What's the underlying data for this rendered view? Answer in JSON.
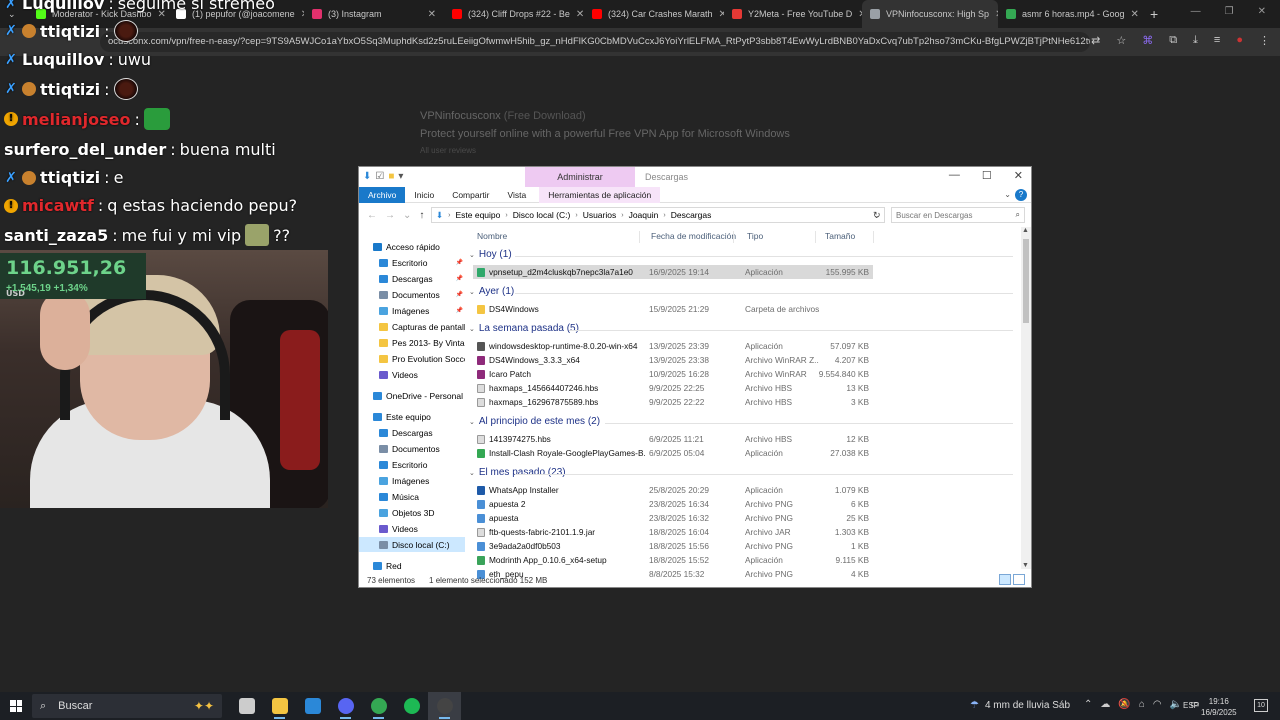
{
  "browser": {
    "tabs": [
      {
        "label": "Moderator - Kick Dashbo",
        "color": "#53fc18"
      },
      {
        "label": "(1) pepufor (@joacomene",
        "color": "#ffffff"
      },
      {
        "label": "(3) Instagram",
        "color": "#e1306c"
      },
      {
        "label": "(324) Cliff Drops #22 - Be",
        "color": "#ff0000"
      },
      {
        "label": "(324) Car Crashes Marath",
        "color": "#ff0000"
      },
      {
        "label": "Y2Meta - Free YouTube D",
        "color": "#e53935"
      },
      {
        "label": "VPNinfocusconx: High Sp",
        "color": "#9aa0a6"
      },
      {
        "label": "asmr 6 horas.mp4 - Goog",
        "color": "#34a853"
      }
    ],
    "url": "ocusconx.com/vpn/free-n-easy/?cep=9TS9A5WJCo1aYbxO5Sq3MuphdKsd2z5ruLEeiigOfwmwH5hib_gz_nHdFlKG0CbMDVuCcxJ6YoiYrlELFMA_RtPytP3sbb8T4EwWyLrdBNB0YaDxCvq7ubTp2hso73mCKu-BfgLPWZjBTjPtNHe612twTU..."
  },
  "background_page": {
    "title": "VPNinfocusconx",
    "subtitle": "(Free Download)",
    "tagline": "Protect yourself online with a powerful Free VPN App for Microsoft Windows",
    "reviews": "All user reviews"
  },
  "chat": [
    {
      "user": "Luquillov",
      "color": "#ffffff",
      "text": "seguime si stremeo",
      "badge": "mod"
    },
    {
      "user": "ttiqtizi",
      "color": "#ffffff",
      "text": "",
      "badge": "sub",
      "emote": "face"
    },
    {
      "user": "Luquillov",
      "color": "#ffffff",
      "text": "uwu",
      "badge": "mod"
    },
    {
      "user": "ttiqtizi",
      "color": "#ffffff",
      "text": "",
      "badge": "sub",
      "emote": "face"
    },
    {
      "user": "melianjoseo",
      "color": "#e0282c",
      "text": "",
      "badge": "warn",
      "emote": "bag"
    },
    {
      "user": "surfero_del_under",
      "color": "#ffffff",
      "text": "buena multi",
      "badge": ""
    },
    {
      "user": "ttiqtizi",
      "color": "#ffffff",
      "text": "e",
      "badge": "sub"
    },
    {
      "user": "micawtf",
      "color": "#e0282c",
      "text": "q estas haciendo pepu?",
      "badge": "warn"
    },
    {
      "user": "santi_zaza5",
      "color": "#ffffff",
      "text": "me fui y mi vip",
      "badge": "",
      "emote": "sus",
      "suffix": "??"
    }
  ],
  "ticker": {
    "price": "116.951,26",
    "currency": "USD",
    "change": "+1.545,19",
    "percent": "+1,34%"
  },
  "explorer": {
    "context_tab": "Administrar",
    "window_title": "Descargas",
    "ribbon": [
      "Archivo",
      "Inicio",
      "Compartir",
      "Vista",
      "Herramientas de aplicación"
    ],
    "breadcrumb": [
      "Este equipo",
      "Disco local (C:)",
      "Usuarios",
      "Joaquin",
      "Descargas"
    ],
    "search_placeholder": "Buscar en Descargas",
    "columns": {
      "name": "Nombre",
      "date": "Fecha de modificación",
      "type": "Tipo",
      "size": "Tamaño"
    },
    "nav": [
      {
        "label": "Acceso rápido",
        "color": "#1979ca",
        "indent": 0,
        "pin": false
      },
      {
        "label": "Escritorio",
        "color": "#2b88d8",
        "indent": 1,
        "pin": true
      },
      {
        "label": "Descargas",
        "color": "#2b88d8",
        "indent": 1,
        "pin": true
      },
      {
        "label": "Documentos",
        "color": "#7a8ea6",
        "indent": 1,
        "pin": true
      },
      {
        "label": "Imágenes",
        "color": "#4aa3df",
        "indent": 1,
        "pin": true
      },
      {
        "label": "Capturas de pantall",
        "color": "#f4c542",
        "indent": 1,
        "pin": false
      },
      {
        "label": "Pes 2013- By Vintag",
        "color": "#f4c542",
        "indent": 1,
        "pin": false
      },
      {
        "label": "Pro Evolution Socce",
        "color": "#f4c542",
        "indent": 1,
        "pin": false
      },
      {
        "label": "Videos",
        "color": "#6a5acd",
        "indent": 1,
        "pin": false
      },
      {
        "label": "OneDrive - Personal",
        "color": "#2b88d8",
        "indent": 0,
        "pin": false
      },
      {
        "label": "Este equipo",
        "color": "#2b88d8",
        "indent": 0,
        "pin": false
      },
      {
        "label": "Descargas",
        "color": "#2b88d8",
        "indent": 1,
        "pin": false
      },
      {
        "label": "Documentos",
        "color": "#7a8ea6",
        "indent": 1,
        "pin": false
      },
      {
        "label": "Escritorio",
        "color": "#2b88d8",
        "indent": 1,
        "pin": false
      },
      {
        "label": "Imágenes",
        "color": "#4aa3df",
        "indent": 1,
        "pin": false
      },
      {
        "label": "Música",
        "color": "#2b88d8",
        "indent": 1,
        "pin": false
      },
      {
        "label": "Objetos 3D",
        "color": "#4aa3df",
        "indent": 1,
        "pin": false
      },
      {
        "label": "Videos",
        "color": "#6a5acd",
        "indent": 1,
        "pin": false
      },
      {
        "label": "Disco local (C:)",
        "color": "#7a8ea6",
        "indent": 1,
        "pin": false,
        "selected": true
      },
      {
        "label": "Red",
        "color": "#2b88d8",
        "indent": 0,
        "pin": false
      }
    ],
    "groups": [
      {
        "label": "Hoy (1)",
        "files": [
          {
            "name": "vpnsetup_d2m4cluskqb7nepc3la7a1e0",
            "date": "16/9/2025 19:14",
            "type": "Aplicación",
            "size": "155.995 KB",
            "icon": "#2fa86a",
            "selected": true
          }
        ]
      },
      {
        "label": "Ayer (1)",
        "files": [
          {
            "name": "DS4Windows",
            "date": "15/9/2025 21:29",
            "type": "Carpeta de archivos",
            "size": "",
            "icon": "#f4c542"
          }
        ]
      },
      {
        "label": "La semana pasada (5)",
        "files": [
          {
            "name": "windowsdesktop-runtime-8.0.20-win-x64",
            "date": "13/9/2025 23:39",
            "type": "Aplicación",
            "size": "57.097 KB",
            "icon": "#555555"
          },
          {
            "name": "DS4Windows_3.3.3_x64",
            "date": "13/9/2025 23:38",
            "type": "Archivo WinRAR Z...",
            "size": "4.207 KB",
            "icon": "#8e2a7a"
          },
          {
            "name": "Icaro Patch",
            "date": "10/9/2025 16:28",
            "type": "Archivo WinRAR",
            "size": "9.554.840 KB",
            "icon": "#8e2a7a"
          },
          {
            "name": "haxmaps_145664407246.hbs",
            "date": "9/9/2025 22:25",
            "type": "Archivo HBS",
            "size": "13 KB",
            "icon": "#dddddd"
          },
          {
            "name": "haxmaps_162967875589.hbs",
            "date": "9/9/2025 22:22",
            "type": "Archivo HBS",
            "size": "3 KB",
            "icon": "#dddddd"
          }
        ]
      },
      {
        "label": "Al principio de este mes (2)",
        "files": [
          {
            "name": "1413974275.hbs",
            "date": "6/9/2025 11:21",
            "type": "Archivo HBS",
            "size": "12 KB",
            "icon": "#dddddd"
          },
          {
            "name": "Install-Clash Royale-GooglePlayGames-B...",
            "date": "6/9/2025 05:04",
            "type": "Aplicación",
            "size": "27.038 KB",
            "icon": "#34a853"
          }
        ]
      },
      {
        "label": "El mes pasado (23)",
        "files": [
          {
            "name": "WhatsApp Installer",
            "date": "25/8/2025 20:29",
            "type": "Aplicación",
            "size": "1.079 KB",
            "icon": "#1e5aa8"
          },
          {
            "name": "apuesta 2",
            "date": "23/8/2025 16:34",
            "type": "Archivo PNG",
            "size": "6 KB",
            "icon": "#4a8fd6"
          },
          {
            "name": "apuesta",
            "date": "23/8/2025 16:32",
            "type": "Archivo PNG",
            "size": "25 KB",
            "icon": "#4a8fd6"
          },
          {
            "name": "ftb-quests-fabric-2101.1.9.jar",
            "date": "18/8/2025 16:04",
            "type": "Archivo JAR",
            "size": "1.303 KB",
            "icon": "#dddddd"
          },
          {
            "name": "3e9ada2a0df0b503",
            "date": "18/8/2025 15:56",
            "type": "Archivo PNG",
            "size": "1 KB",
            "icon": "#4a8fd6"
          },
          {
            "name": "Modrinth App_0.10.6_x64-setup",
            "date": "18/8/2025 15:52",
            "type": "Aplicación",
            "size": "9.115 KB",
            "icon": "#3aa35a"
          },
          {
            "name": "eth_pepu",
            "date": "8/8/2025 15:32",
            "type": "Archivo PNG",
            "size": "4 KB",
            "icon": "#4a8fd6"
          }
        ]
      }
    ],
    "status": {
      "count": "73 elementos",
      "selection": "1 elemento seleccionado  152 MB"
    }
  },
  "taskbar": {
    "search_label": "Buscar",
    "apps": [
      {
        "name": "task-view",
        "color": "#cccccc"
      },
      {
        "name": "file-explorer",
        "color": "#f4c542",
        "running": true
      },
      {
        "name": "store",
        "color": "#2b88d8"
      },
      {
        "name": "discord",
        "color": "#5865f2",
        "running": true
      },
      {
        "name": "chrome",
        "color": "#34a853",
        "running": true
      },
      {
        "name": "spotify",
        "color": "#1db954"
      },
      {
        "name": "obs",
        "color": "#444444",
        "running": true,
        "active": true
      }
    ],
    "weather": "4 mm de lluvia Sáb",
    "language": "ESP",
    "time": "19:16",
    "date": "16/9/2025",
    "notifications": "10"
  }
}
